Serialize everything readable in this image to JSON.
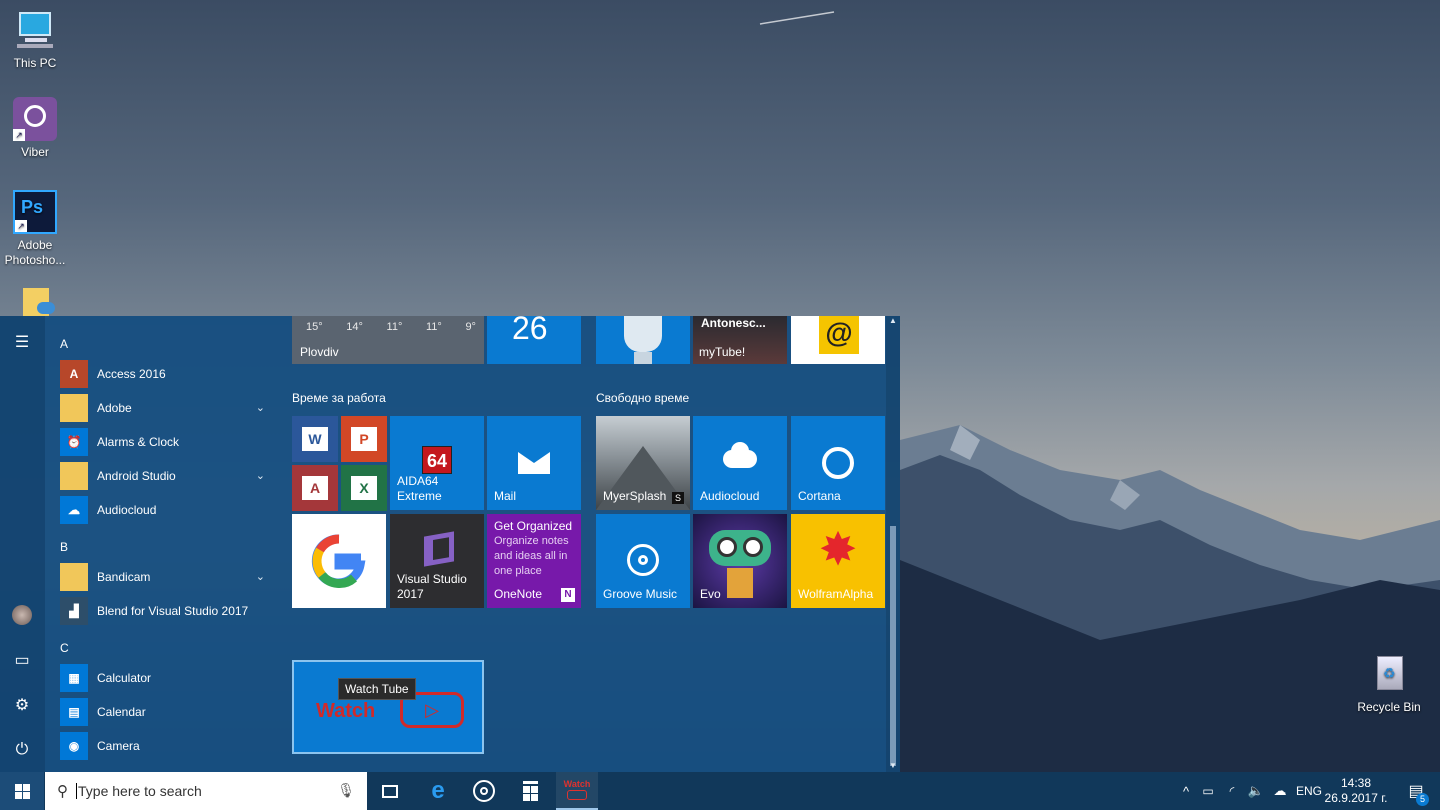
{
  "desktop": {
    "icons": [
      {
        "label": "This PC"
      },
      {
        "label": "Viber"
      },
      {
        "label": "Adobe Photosho..."
      },
      {
        "label": "Recycle Bin"
      }
    ]
  },
  "start_menu": {
    "letters": [
      "A",
      "B",
      "C"
    ],
    "apps": [
      {
        "label": "Access 2016",
        "icon": "access-icon",
        "color": "#b7472a"
      },
      {
        "label": "Adobe",
        "icon": "folder-icon",
        "color": "#f1c75a",
        "expandable": true
      },
      {
        "label": "Alarms & Clock",
        "icon": "alarm-clock-icon",
        "color": "#0078d7"
      },
      {
        "label": "Android Studio",
        "icon": "folder-icon",
        "color": "#f1c75a",
        "expandable": true
      },
      {
        "label": "Audiocloud",
        "icon": "cloud-icon",
        "color": "#0078d7"
      },
      {
        "label": "Bandicam",
        "icon": "folder-icon",
        "color": "#f1c75a",
        "expandable": true
      },
      {
        "label": "Blend for Visual Studio 2017",
        "icon": "blend-icon",
        "color": "#2d4e6a"
      },
      {
        "label": "Calculator",
        "icon": "calculator-icon",
        "color": "#0078d7"
      },
      {
        "label": "Calendar",
        "icon": "calendar-icon",
        "color": "#0078d7"
      },
      {
        "label": "Camera",
        "icon": "camera-icon",
        "color": "#0078d7"
      }
    ],
    "weather": {
      "temps": [
        "15°",
        "14°",
        "11°",
        "11°",
        "9°"
      ],
      "city": "Plovdiv"
    },
    "calendar_day": "26",
    "top_tiles": {
      "mytube_title": "Antonesc...",
      "mytube_label": "myTube!"
    },
    "groups": {
      "work": "Време за работа",
      "free": "Свободно време"
    },
    "tiles": {
      "word": "W",
      "powerpoint": "P",
      "access": "A",
      "excel": "X",
      "aida": "AIDA64 Extreme",
      "aida_badge": "64",
      "mail": "Mail",
      "visual_studio": "Visual Studio 2017",
      "onenote_title": "Get Organized",
      "onenote_text": "Organize notes and ideas all in one place",
      "onenote": "OneNote",
      "myersplash": "MyerSplash",
      "audiocloud": "Audiocloud",
      "cortana": "Cortana",
      "groove": "Groove Music",
      "evo": "Evo",
      "wolfram": "WolframAlpha",
      "watchtube_tooltip": "Watch Tube",
      "watchtube_logo": "Watch"
    }
  },
  "taskbar": {
    "search_placeholder": "Type here to search",
    "watch_label": "Watch",
    "language": "ENG",
    "time": "14:38",
    "date": "26.9.2017 г.",
    "notifications": "5"
  }
}
